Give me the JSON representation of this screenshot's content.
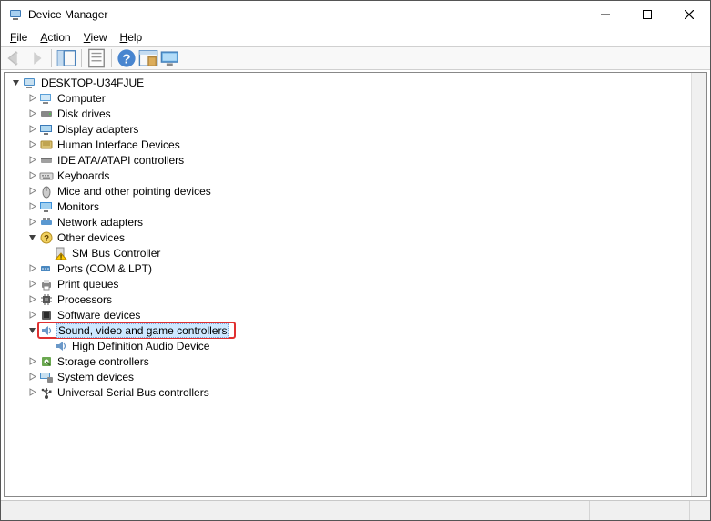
{
  "window": {
    "title": "Device Manager"
  },
  "menu": {
    "file": "File",
    "action": "Action",
    "view": "View",
    "help": "Help"
  },
  "toolbar": {
    "back": "Back",
    "forward": "Forward",
    "show_hide": "Show/Hide Console Tree",
    "properties": "Properties",
    "help": "Help",
    "scan": "Scan for hardware changes",
    "monitor": "Add legacy hardware"
  },
  "tree": {
    "root": "DESKTOP-U34FJUE",
    "items": [
      {
        "label": "Computer",
        "icon": "computer"
      },
      {
        "label": "Disk drives",
        "icon": "disk"
      },
      {
        "label": "Display adapters",
        "icon": "display"
      },
      {
        "label": "Human Interface Devices",
        "icon": "hid"
      },
      {
        "label": "IDE ATA/ATAPI controllers",
        "icon": "ide"
      },
      {
        "label": "Keyboards",
        "icon": "keyboard"
      },
      {
        "label": "Mice and other pointing devices",
        "icon": "mouse"
      },
      {
        "label": "Monitors",
        "icon": "monitor"
      },
      {
        "label": "Network adapters",
        "icon": "network"
      },
      {
        "label": "Other devices",
        "icon": "other",
        "expanded": true,
        "children": [
          {
            "label": "SM Bus Controller",
            "icon": "warning"
          }
        ]
      },
      {
        "label": "Ports (COM & LPT)",
        "icon": "ports"
      },
      {
        "label": "Print queues",
        "icon": "printer"
      },
      {
        "label": "Processors",
        "icon": "processor"
      },
      {
        "label": "Software devices",
        "icon": "software"
      },
      {
        "label": "Sound, video and game controllers",
        "icon": "sound",
        "expanded": true,
        "selected": true,
        "highlighted": true,
        "children": [
          {
            "label": "High Definition Audio Device",
            "icon": "sound"
          }
        ]
      },
      {
        "label": "Storage controllers",
        "icon": "storage"
      },
      {
        "label": "System devices",
        "icon": "system"
      },
      {
        "label": "Universal Serial Bus controllers",
        "icon": "usb"
      }
    ]
  }
}
